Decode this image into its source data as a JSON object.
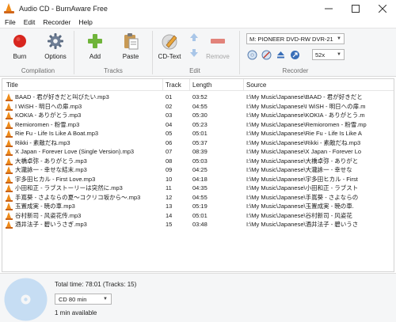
{
  "window": {
    "title": "Audio CD - BurnAware Free"
  },
  "menu": [
    "File",
    "Edit",
    "Recorder",
    "Help"
  ],
  "ribbon": {
    "compilation": {
      "label": "Compilation",
      "burn": "Burn",
      "options": "Options"
    },
    "tracks": {
      "label": "Tracks",
      "add": "Add",
      "paste": "Paste"
    },
    "edit": {
      "label": "Edit",
      "cdtext": "CD-Text",
      "remove": "Remove"
    },
    "recorder": {
      "label": "Recorder",
      "drive": "M: PIONEER DVD-RW  DVR-21",
      "speed": "52x"
    }
  },
  "table": {
    "columns": {
      "title": "Title",
      "track": "Track",
      "length": "Length",
      "source": "Source"
    },
    "rows": [
      {
        "title": "BAAD - 君が好きだと叫びたい.mp3",
        "track": "01",
        "length": "03:52",
        "source": "I:\\My Music\\Japanese\\BAAD - 君が好きだと"
      },
      {
        "title": "I WiSH - 明日への扉.mp3",
        "track": "02",
        "length": "04:55",
        "source": "I:\\My Music\\Japanese\\I WiSH - 明日への扉.m"
      },
      {
        "title": "KOKIA - ありがとう.mp3",
        "track": "03",
        "length": "05:30",
        "source": "I:\\My Music\\Japanese\\KOKIA - ありがとう.m"
      },
      {
        "title": "Remioromen - 粉雪.mp3",
        "track": "04",
        "length": "05:23",
        "source": "I:\\My Music\\Japanese\\Remioromen - 粉雪.mp"
      },
      {
        "title": "Rie Fu - Life Is Like A Boat.mp3",
        "track": "05",
        "length": "05:01",
        "source": "I:\\My Music\\Japanese\\Rie Fu - Life Is Like A"
      },
      {
        "title": "Rikki - 素敵だね.mp3",
        "track": "06",
        "length": "05:37",
        "source": "I:\\My Music\\Japanese\\Rikki - 素敵だね.mp3"
      },
      {
        "title": "X Japan - Forever Love (Single Version).mp3",
        "track": "07",
        "length": "08:39",
        "source": "I:\\My Music\\Japanese\\X Japan - Forever Lo"
      },
      {
        "title": "大橋卓弥 - ありがとう.mp3",
        "track": "08",
        "length": "05:03",
        "source": "I:\\My Music\\Japanese\\大橋卓弥 - ありがと"
      },
      {
        "title": "大瀧詠一 - 幸せな結末.mp3",
        "track": "09",
        "length": "04:25",
        "source": "I:\\My Music\\Japanese\\大瀧詠一 - 幸せな"
      },
      {
        "title": "宇多田ヒカル - First Love.mp3",
        "track": "10",
        "length": "04:18",
        "source": "I:\\My Music\\Japanese\\宇多田ヒカル - First"
      },
      {
        "title": "小田和正 - ラブストーリーは突然に.mp3",
        "track": "11",
        "length": "04:35",
        "source": "I:\\My Music\\Japanese\\小田和正 - ラブスト"
      },
      {
        "title": "手嶌葵 - さよならの夏～コクリコ坂から～.mp3",
        "track": "12",
        "length": "04:55",
        "source": "I:\\My Music\\Japanese\\手嶌葵 - さよならの"
      },
      {
        "title": "玉置成実 - 暁の車.mp3",
        "track": "13",
        "length": "05:19",
        "source": "I:\\My Music\\Japanese\\玉置成実 - 暁の車."
      },
      {
        "title": "谷村新司 - 风姿花传.mp3",
        "track": "14",
        "length": "05:01",
        "source": "I:\\My Music\\Japanese\\谷村新司 - 风姿花"
      },
      {
        "title": "酒井法子 - 碧いうさぎ.mp3",
        "track": "15",
        "length": "03:48",
        "source": "I:\\My Music\\Japanese\\酒井法子 - 碧いうさ"
      }
    ]
  },
  "status": {
    "total": "Total time: 78:01 (Tracks: 15)",
    "disc_type": "CD 80 min",
    "available": "1 min available"
  },
  "icons": {
    "burn": "red-circle",
    "options": "gear",
    "add": "green-plus",
    "paste": "clipboard",
    "cdtext": "pen-on-disc",
    "remove": "red-minus",
    "track_file": "vlc-cone"
  },
  "colors": {
    "accent": "#f08c1a",
    "burn": "#d8261f",
    "add": "#6fb43a",
    "remove": "#e2837a",
    "disc": "#c6ddf3"
  }
}
